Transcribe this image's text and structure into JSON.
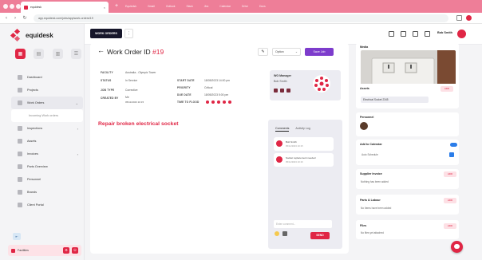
{
  "browser": {
    "tab_title": "equidesk",
    "tabstrip": [
      "Equiedsk",
      "Gmail",
      "Outlook",
      "Slack",
      "Jira",
      "Calendar",
      "Drive",
      "Docs"
    ],
    "url": "app.equidesk.com/jobs/app/work-orders/19"
  },
  "brand": {
    "name": "equidesk"
  },
  "sidebar": {
    "items": [
      {
        "label": "Dashboard"
      },
      {
        "label": "Projects"
      },
      {
        "label": "Work Orders"
      },
      {
        "label": "Incoming Work orders"
      },
      {
        "label": "Inspections"
      },
      {
        "label": "Assets"
      },
      {
        "label": "Invoices"
      },
      {
        "label": "Parts Overview"
      },
      {
        "label": "Personnel"
      },
      {
        "label": "Brands"
      },
      {
        "label": "Client Portal"
      }
    ],
    "user_label": "Facilities"
  },
  "topbar": {
    "work_orders_btn": "WORK ORDERS",
    "more_btn": "⋮",
    "user_name": "Bob Smith"
  },
  "work_order": {
    "title_prefix": "Work Order ID",
    "id": "#19",
    "options_label": "Option",
    "save_label": "Save Job",
    "fields_left": [
      {
        "label": "FACILITY",
        "value": "Australia - Olympic Tower"
      },
      {
        "label": "STATUS",
        "value": "In Service"
      },
      {
        "label": "JOB TYPE",
        "value": "Corrective"
      },
      {
        "label": "CREATED BY",
        "value": "Me"
      }
    ],
    "created_date": "05/11/2023 10:15",
    "fields_right": [
      {
        "label": "START DATE",
        "value": "18/05/2023 14:00 pm"
      },
      {
        "label": "PRIORITY",
        "value": "Critical"
      },
      {
        "label": "DUE DATE",
        "value": "18/05/2023 5:00 pm"
      },
      {
        "label": "TIME TO FLOOD",
        "value": ""
      }
    ],
    "manager_label": "WO Manager",
    "manager_name": "Bob Smith",
    "repair_title": "Repair broken electrical socket"
  },
  "comments": {
    "tabs": [
      "Comments",
      "Activity Log"
    ],
    "items": [
      {
        "author": "Bob Smith",
        "time": "05/11/2023 10:15"
      },
      {
        "author": "Socket replacement needed",
        "time": "05/11/2023 10:16"
      }
    ],
    "placeholder": "Enter comment...",
    "send_label": "SEND"
  },
  "right": {
    "media_label": "Media",
    "assets_label": "Assets",
    "add_label": "ADD",
    "assets_chip": "Electrical Socket 2345",
    "personnel_label": "Personnel",
    "calendar_label": "Add to Calendar",
    "calendar_sub": "Auto Schedule",
    "supplier_label": "Supplier Invoice",
    "supplier_sub": "Nothing has been added",
    "parts_label": "Parts & Labour",
    "parts_sub": "No Items have been added",
    "files_label": "Files",
    "files_sub": "No files yet attached"
  }
}
